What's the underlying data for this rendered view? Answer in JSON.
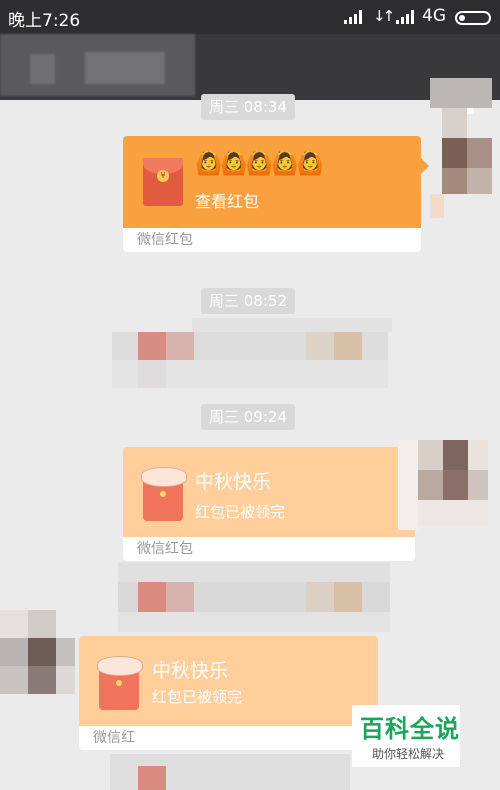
{
  "status_bar": {
    "time": "晚上7:26",
    "network": "4G"
  },
  "messages": [
    {
      "type": "time",
      "text": "周三 08:34"
    },
    {
      "type": "red_packet",
      "direction": "out",
      "title_emoji": "🙆🙆🙆🙆🙆",
      "subtitle": "查看红包",
      "footer": "微信红包",
      "state": "unopened",
      "color": "#f9a03f"
    },
    {
      "type": "time",
      "text": "周三 08:52"
    },
    {
      "type": "time",
      "text": "周三 09:24"
    },
    {
      "type": "red_packet",
      "direction": "out",
      "title": "中秋快乐",
      "subtitle": "红包已被领完",
      "footer": "微信红包",
      "state": "claimed",
      "color": "#ffce9a"
    },
    {
      "type": "red_packet",
      "direction": "in",
      "title": "中秋快乐",
      "subtitle": "红包已被领完",
      "footer": "微信红",
      "state": "claimed",
      "color": "#ffce9a"
    }
  ],
  "watermark": {
    "title": "百科全说",
    "subtitle": "助你轻松解决"
  }
}
